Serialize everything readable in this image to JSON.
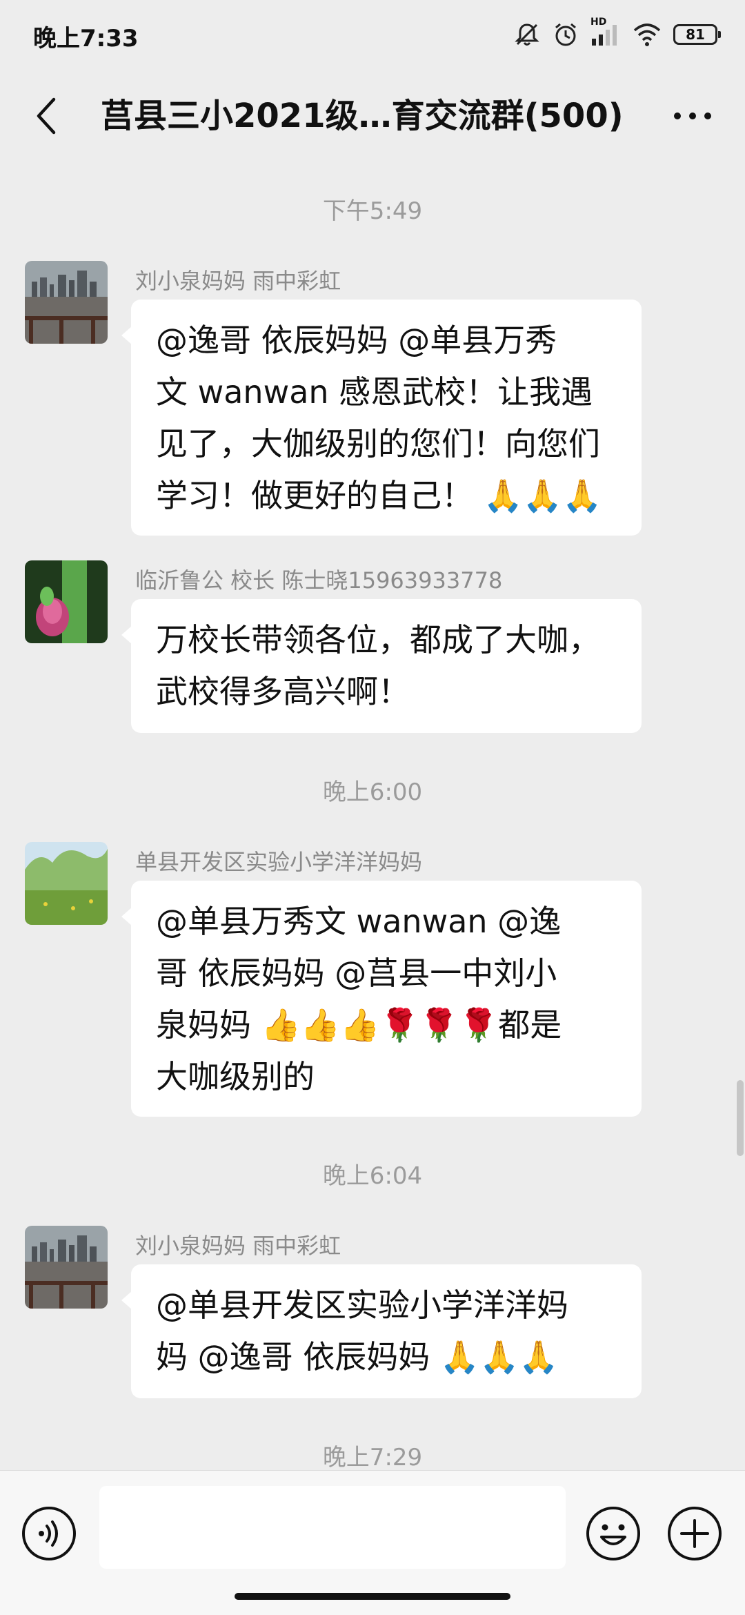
{
  "status_bar": {
    "time": "晚上7:33",
    "battery": "81",
    "hd_label": "HD"
  },
  "header": {
    "title": "莒县三小2021级…育交流群(500)",
    "back_icon": "chevron-left-icon",
    "more_icon": "ellipsis-icon"
  },
  "messages": [
    {
      "timestamp": "下午5:49",
      "sender": "刘小泉妈妈  雨中彩虹",
      "avatar": "avatar-lake-city",
      "lines": [
        "@逸哥 依辰妈妈 @单县万秀",
        "文  wanwan 感恩武校！让我遇",
        "见了，大伽级别的您们！向您们",
        "学习！做更好的自己！ 🙏🙏🙏"
      ]
    },
    {
      "timestamp": "",
      "sender": "临沂鲁公 校长  陈士晓15963933778",
      "avatar": "avatar-lotus",
      "lines": [
        "万校长带领各位，都成了大咖，",
        "武校得多高兴啊！"
      ]
    },
    {
      "timestamp": "晚上6:00",
      "sender": "单县开发区实验小学洋洋妈妈",
      "avatar": "avatar-meadow",
      "lines": [
        "@单县万秀文  wanwan @逸",
        "哥 依辰妈妈  @莒县一中刘小",
        "泉妈妈 👍👍👍🌹🌹🌹都是",
        "大咖级别的"
      ]
    },
    {
      "timestamp": "晚上6:04",
      "sender": "刘小泉妈妈  雨中彩虹",
      "avatar": "avatar-lake-city",
      "lines": [
        "@单县开发区实验小学洋洋妈",
        "妈  @逸哥 依辰妈妈   🙏🙏🙏"
      ]
    }
  ],
  "last_timestamp": "晚上7:29",
  "input_bar": {
    "voice_icon": "voice-icon",
    "emoji_icon": "smiley-icon",
    "plus_icon": "plus-icon",
    "text_value": ""
  },
  "colors": {
    "background": "#ededed",
    "bubble": "#ffffff",
    "meta_text": "#9b9b9b"
  }
}
